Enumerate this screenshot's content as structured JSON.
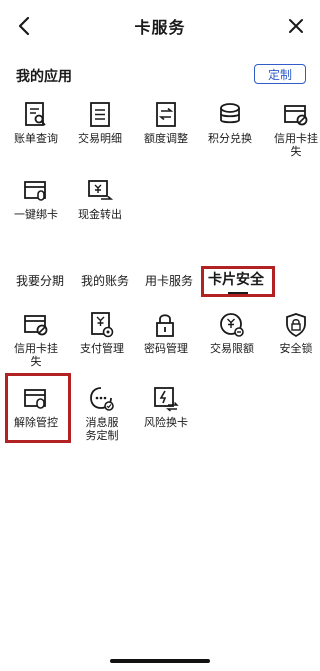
{
  "header": {
    "title": "卡服务",
    "back_icon": "chevron-left-icon",
    "close_icon": "close-icon"
  },
  "my_apps": {
    "title": "我的应用",
    "customize_label": "定制",
    "items": [
      {
        "label": "账单查询",
        "icon": "bill-search-icon"
      },
      {
        "label": "交易明细",
        "icon": "transaction-detail-icon"
      },
      {
        "label": "额度调整",
        "icon": "limit-adjust-icon"
      },
      {
        "label": "积分兑换",
        "icon": "points-exchange-icon"
      },
      {
        "label": "信用卡挂失",
        "icon": "card-loss-report-icon"
      },
      {
        "label": "一键绑卡",
        "icon": "bind-card-icon"
      },
      {
        "label": "现金转出",
        "icon": "cash-transfer-icon"
      }
    ]
  },
  "tabs": [
    {
      "label": "我要分期",
      "active": false
    },
    {
      "label": "我的账务",
      "active": false
    },
    {
      "label": "用卡服务",
      "active": false
    },
    {
      "label": "卡片安全",
      "active": true
    }
  ],
  "security_items": [
    {
      "label": "信用卡挂失",
      "icon": "card-loss-report-icon"
    },
    {
      "label": "支付管理",
      "icon": "payment-management-icon"
    },
    {
      "label": "密码管理",
      "icon": "password-lock-icon"
    },
    {
      "label": "交易限额",
      "icon": "transaction-limit-icon"
    },
    {
      "label": "安全锁",
      "icon": "security-lock-icon"
    },
    {
      "label": "解除管控",
      "icon": "release-control-icon"
    },
    {
      "label": "消息服务定制",
      "icon": "message-service-icon"
    },
    {
      "label": "风险换卡",
      "icon": "risk-card-replace-icon"
    }
  ],
  "colors": {
    "accent": "#2f5cc8",
    "highlight_border": "#b22222",
    "text": "#1a1a1a"
  }
}
